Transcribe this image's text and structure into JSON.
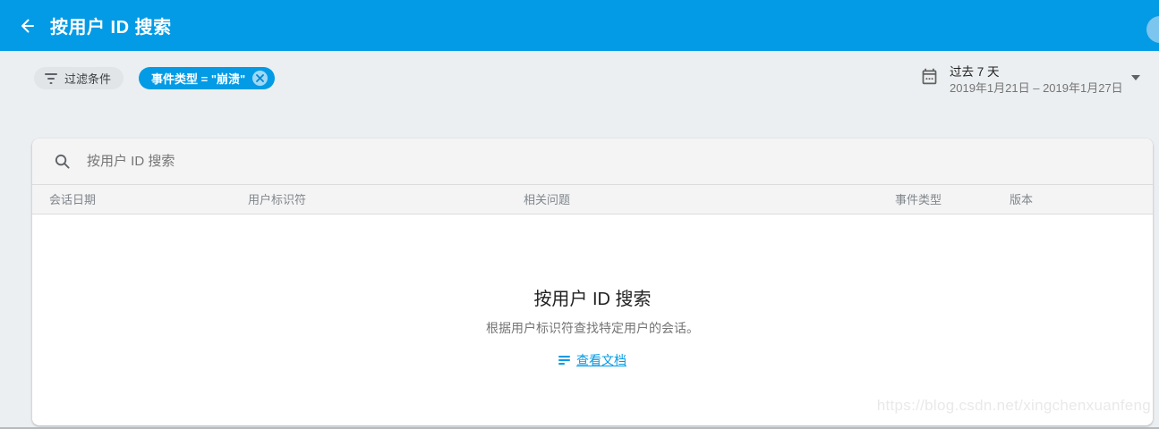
{
  "header": {
    "title": "按用户 ID 搜索"
  },
  "filters": {
    "filter_button_label": "过滤条件",
    "active_chip_label": "事件类型 = \"崩溃\""
  },
  "date_picker": {
    "label": "过去 7 天",
    "range": "2019年1月21日 – 2019年1月27日"
  },
  "search": {
    "placeholder": "按用户 ID 搜索",
    "value": ""
  },
  "table": {
    "columns": [
      "会话日期",
      "用户标识符",
      "相关问题",
      "事件类型",
      "版本"
    ]
  },
  "empty_state": {
    "title": "按用户 ID 搜索",
    "description": "根据用户标识符查找特定用户的会话。",
    "link_label": "查看文档"
  },
  "watermark": "https://blog.csdn.net/xingchenxuanfeng",
  "colors": {
    "appbar_bg": "#039be5",
    "accent": "#039be5",
    "page_bg": "#eceff1",
    "chip_gray_bg": "#e2e5e8"
  }
}
